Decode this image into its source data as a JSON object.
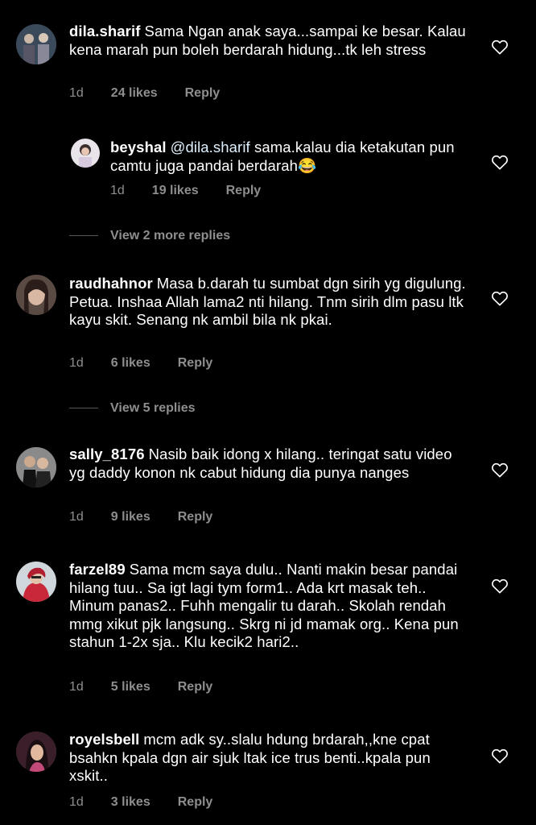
{
  "comments": [
    {
      "username": "dila.sharif",
      "text": "Sama Ngan anak saya...sampai ke besar. Kalau kena marah pun boleh berdarah hidung...tk leh stress",
      "time": "1d",
      "likes": "24 likes",
      "reply": "Reply"
    },
    {
      "username": "beyshal",
      "mention": "@dila.sharif",
      "text": " sama.kalau dia ketakutan pun camtu juga pandai berdarah😂",
      "time": "1d",
      "likes": "19 likes",
      "reply": "Reply"
    },
    {
      "username": "raudhahnor",
      "text": "Masa b.darah tu sumbat dgn sirih yg digulung. Petua. Inshaa Allah lama2 nti hilang. Tnm sirih dlm pasu ltk kayu skit. Senang nk ambil bila nk pkai.",
      "time": "1d",
      "likes": "6 likes",
      "reply": "Reply"
    },
    {
      "username": "sally_8176",
      "text": "Nasib baik idong x hilang.. teringat satu video yg daddy konon nk cabut hidung dia punya nanges",
      "time": "1d",
      "likes": "9 likes",
      "reply": "Reply"
    },
    {
      "username": "farzel89",
      "text": "Sama mcm saya dulu.. Nanti makin besar pandai hilang tuu.. Sa igt lagi tym form1.. Ada krt masak teh.. Minum panas2.. Fuhh mengalir tu darah.. Skolah rendah mmg xikut pjk langsung.. Skrg ni jd mamak org.. Kena pun stahun 1-2x sja.. Klu kecik2 hari2..",
      "time": "1d",
      "likes": "5 likes",
      "reply": "Reply"
    },
    {
      "username": "royelsbell",
      "text": "mcm adk sy..slalu hdung brdarah,,kne cpat bsahkn kpala dgn air sjuk ltak ice trus benti..kpala pun xskit..",
      "time": "1d",
      "likes": "3 likes",
      "reply": "Reply"
    }
  ],
  "view_replies": [
    "View 2 more replies",
    "View 5 replies"
  ],
  "colors": {
    "background": "#000000",
    "text": "#ffffff",
    "meta": "#8e8e8e"
  }
}
